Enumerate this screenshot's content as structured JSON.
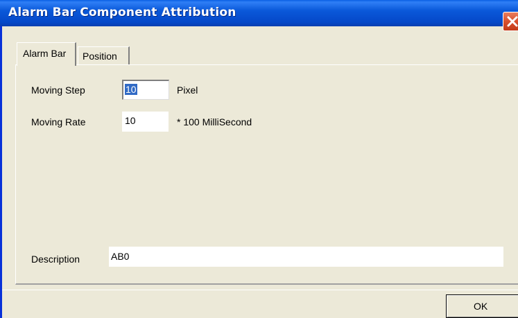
{
  "window": {
    "title": "Alarm Bar Component Attribution",
    "close_icon": "close-icon",
    "colors": {
      "titlebar": "#0a58d9",
      "close_button": "#d8502e",
      "face": "#ece9d8",
      "selection": "#316ac5"
    }
  },
  "tabs": [
    {
      "label": "Alarm Bar",
      "active": true
    },
    {
      "label": "Position",
      "active": false
    }
  ],
  "form": {
    "moving_step": {
      "label": "Moving Step",
      "value": "10",
      "unit": "Pixel"
    },
    "moving_rate": {
      "label": "Moving Rate",
      "value": "10",
      "unit": "* 100 MilliSecond"
    },
    "description": {
      "label": "Description",
      "value": "AB0"
    }
  },
  "buttons": {
    "ok_label": "OK"
  }
}
